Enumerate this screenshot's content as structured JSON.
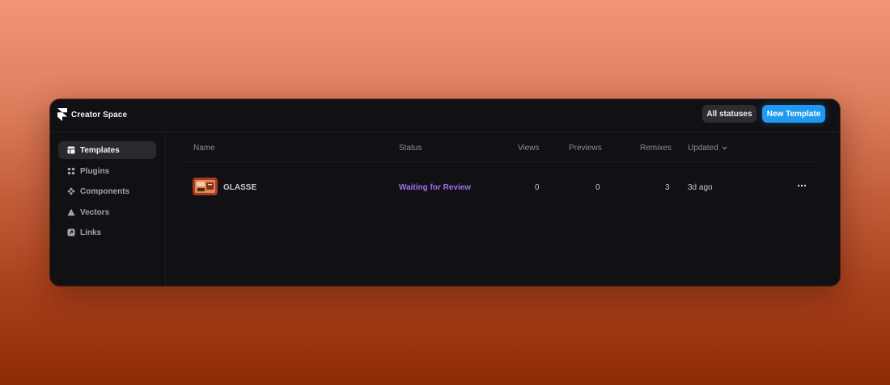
{
  "app": {
    "title": "Creator Space"
  },
  "toolbar": {
    "filter_label": "All statuses",
    "new_label": "New Template"
  },
  "sidebar": {
    "items": [
      {
        "label": "Templates",
        "icon": "template-icon",
        "active": true
      },
      {
        "label": "Plugins",
        "icon": "plugin-icon",
        "active": false
      },
      {
        "label": "Components",
        "icon": "component-icon",
        "active": false
      },
      {
        "label": "Vectors",
        "icon": "vector-icon",
        "active": false
      },
      {
        "label": "Links",
        "icon": "link-icon",
        "active": false
      }
    ]
  },
  "table": {
    "columns": [
      "Name",
      "Status",
      "Views",
      "Previews",
      "Remixes",
      "Updated"
    ],
    "sort_column": "Updated",
    "rows": [
      {
        "name": "GLASSE",
        "status": "Waiting for Review",
        "views": "0",
        "previews": "0",
        "remixes": "3",
        "updated": "3d ago"
      }
    ]
  },
  "colors": {
    "accent": "#1e9bf0",
    "status_review": "#a070f0",
    "window_bg": "#111014"
  }
}
